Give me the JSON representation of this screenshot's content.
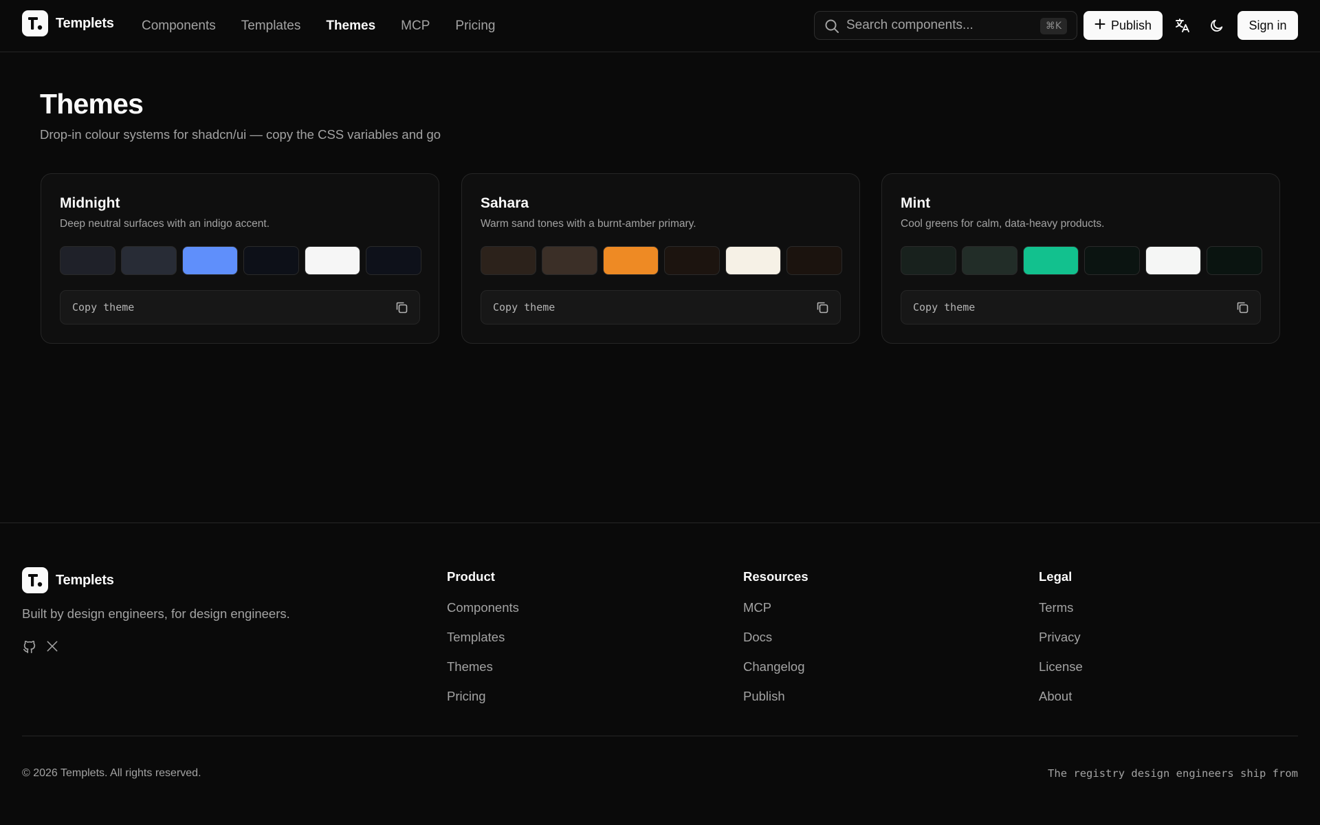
{
  "header": {
    "brand": "Templets",
    "nav": [
      {
        "label": "Components",
        "active": false
      },
      {
        "label": "Templates",
        "active": false
      },
      {
        "label": "Themes",
        "active": true
      },
      {
        "label": "MCP",
        "active": false
      },
      {
        "label": "Pricing",
        "active": false
      }
    ],
    "search": {
      "placeholder": "Search components...",
      "shortcut": "⌘K"
    },
    "publish_label": "Publish",
    "signin_label": "Sign in",
    "icons": [
      "search-icon",
      "plus-icon",
      "translate-icon",
      "moon-icon"
    ]
  },
  "main": {
    "title": "Themes",
    "subtitle": "Drop-in colour systems for shadcn/ui — copy the CSS variables and go",
    "themes": [
      {
        "name": "Midnight",
        "description": "Deep neutral surfaces with an indigo accent.",
        "swatches": [
          "#1f2129",
          "#282c36",
          "#5f8ffb",
          "#0d1018",
          "#f6f6f6",
          "#0e111a"
        ],
        "copy_label": "Copy theme"
      },
      {
        "name": "Sahara",
        "description": "Warm sand tones with a burnt-amber primary.",
        "swatches": [
          "#2c221b",
          "#3b2f27",
          "#ee8a24",
          "#1c140f",
          "#f6f1e6",
          "#1b130e"
        ],
        "copy_label": "Copy theme"
      },
      {
        "name": "Mint",
        "description": "Cool greens for calm, data-heavy products.",
        "swatches": [
          "#18211d",
          "#222d28",
          "#12c18e",
          "#0b1411",
          "#f5f6f5",
          "#0a1410"
        ],
        "copy_label": "Copy theme"
      }
    ]
  },
  "footer": {
    "brand": "Templets",
    "tagline": "Built by design engineers, for design engineers.",
    "social_icons": [
      "github-icon",
      "x-icon"
    ],
    "columns": [
      {
        "heading": "Product",
        "links": [
          "Components",
          "Templates",
          "Themes",
          "Pricing"
        ]
      },
      {
        "heading": "Resources",
        "links": [
          "MCP",
          "Docs",
          "Changelog",
          "Publish"
        ]
      },
      {
        "heading": "Legal",
        "links": [
          "Terms",
          "Privacy",
          "License",
          "About"
        ]
      }
    ],
    "copyright": "© 2026 Templets. All rights reserved.",
    "slogan": "The registry design engineers ship from"
  }
}
